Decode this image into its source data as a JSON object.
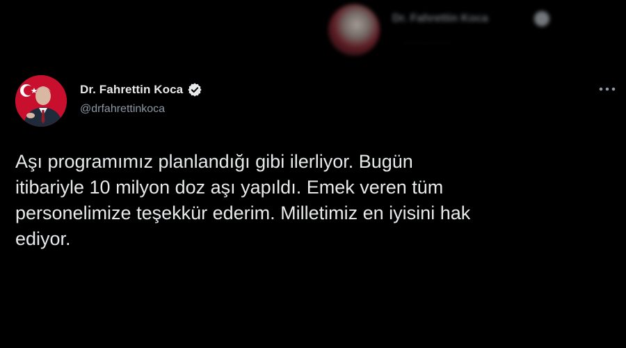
{
  "background_tweet": {
    "display_name": "Dr. Fahrettin Koca",
    "handle": "· · · · · · · · ·"
  },
  "tweet": {
    "display_name": "Dr. Fahrettin Koca",
    "handle": "@drfahrettinkoca",
    "text": "Aşı programımız planlandığı gibi ilerliyor. Bugün\nitibariyle 10 milyon doz aşı yapıldı. Emek veren tüm\npersonelimize teşekkür ederim. Milletimiz en iyisini hak\nediyor.",
    "icons": {
      "verified": "verified-badge-icon",
      "more": "more-options-icon"
    }
  },
  "colors": {
    "background": "#000000",
    "text_primary": "#e7e9ea",
    "text_secondary": "#8b98a5",
    "avatar_red": "#c8102e"
  }
}
